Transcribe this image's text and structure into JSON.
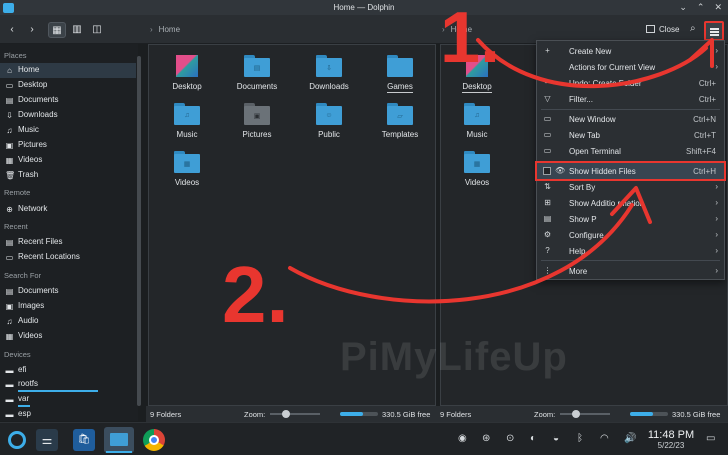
{
  "window": {
    "title": "Home — Dolphin",
    "controls": [
      "⌄",
      "⌃",
      "✕"
    ]
  },
  "toolbar": {
    "breadcrumb_left": "Home",
    "breadcrumb_right": "Home",
    "close_split": "Close"
  },
  "sidebar": {
    "places_heading": "Places",
    "places": [
      "Home",
      "Desktop",
      "Documents",
      "Downloads",
      "Music",
      "Pictures",
      "Videos",
      "Trash"
    ],
    "remote_heading": "Remote",
    "remote": [
      "Network"
    ],
    "recent_heading": "Recent",
    "recent": [
      "Recent Files",
      "Recent Locations"
    ],
    "search_heading": "Search For",
    "search": [
      "Documents",
      "Images",
      "Audio",
      "Videos"
    ],
    "devices_heading": "Devices",
    "devices": [
      "efi",
      "rootfs",
      "var",
      "esp"
    ]
  },
  "left_pane": {
    "items": [
      "Desktop",
      "Documents",
      "Downloads",
      "Games",
      "Music",
      "Pictures",
      "Public",
      "Templates",
      "Videos"
    ]
  },
  "right_pane": {
    "items": [
      "Desktop",
      "Music",
      "Videos"
    ]
  },
  "status": {
    "count": "9 Folders",
    "zoom_label": "Zoom:",
    "free": "330.5 GiB free"
  },
  "menu": {
    "items": [
      {
        "label": "Create New",
        "icon": "+",
        "shortcut": "",
        "arrow": "›"
      },
      {
        "label": "Actions for Current View",
        "icon": "",
        "shortcut": "",
        "arrow": "›"
      },
      {
        "label": "Undo: Create Folder",
        "icon": "↶",
        "shortcut": "Ctrl+",
        "arrow": ""
      },
      {
        "label": "Filter...",
        "icon": "▽",
        "shortcut": "Ctrl+",
        "arrow": ""
      },
      {
        "label": "New Window",
        "icon": "▭",
        "shortcut": "Ctrl+N",
        "arrow": ""
      },
      {
        "label": "New Tab",
        "icon": "▭",
        "shortcut": "Ctrl+T",
        "arrow": ""
      },
      {
        "label": "Open Terminal",
        "icon": "▭",
        "shortcut": "Shift+F4",
        "arrow": ""
      },
      {
        "label": "Show Hidden Files",
        "icon": "👁",
        "shortcut": "Ctrl+H",
        "arrow": ""
      },
      {
        "label": "Sort By",
        "icon": "⇅",
        "shortcut": "",
        "arrow": "›"
      },
      {
        "label": "Show Additio      rmation",
        "icon": "⊞",
        "shortcut": "",
        "arrow": "›"
      },
      {
        "label": "Show P",
        "icon": "▤",
        "shortcut": "",
        "arrow": "›"
      },
      {
        "label": "Configure",
        "icon": "⚙",
        "shortcut": "",
        "arrow": "›"
      },
      {
        "label": "Help",
        "icon": "?",
        "shortcut": "",
        "arrow": "›"
      },
      {
        "label": "More",
        "icon": "⋮",
        "shortcut": "",
        "arrow": "›"
      }
    ]
  },
  "taskbar": {
    "time": "11:48 PM",
    "date": "5/22/23"
  },
  "annotations": {
    "step1": "1.",
    "step2": "2."
  },
  "watermark": "PiMyLifeUp",
  "colors": {
    "accent": "#3daee9",
    "annotation_red": "#e8362f",
    "folder_blue": "#3f9ed6"
  }
}
